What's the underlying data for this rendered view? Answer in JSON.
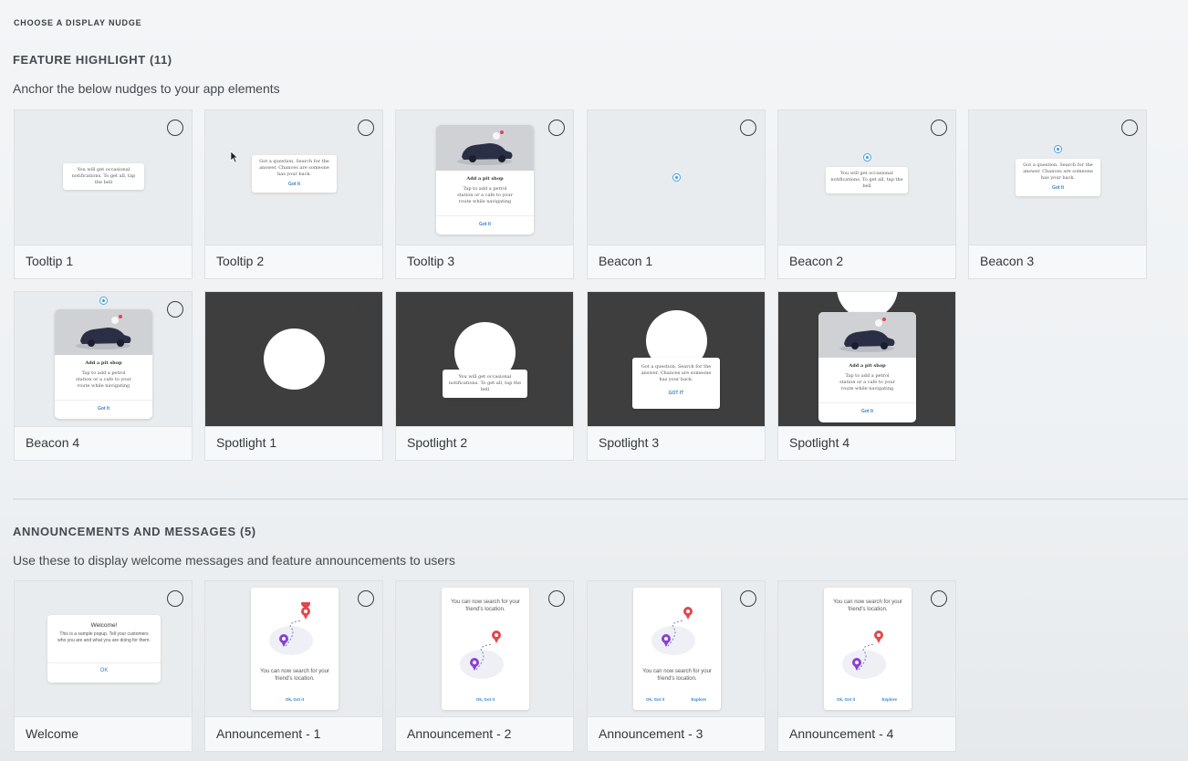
{
  "header": {
    "title": "CHOOSE A DISPLAY NUDGE"
  },
  "feature_highlight": {
    "title": "FEATURE HIGHLIGHT (11)",
    "description": "Anchor the below nudges to your app elements",
    "cards": [
      {
        "label": "Tooltip 1",
        "preview_text": "You will get occasional notifications. To get all, tap the bell"
      },
      {
        "label": "Tooltip 2",
        "preview_text": "Got a question. Search for the answer. Chances are someone has your back.",
        "preview_action": "Got It"
      },
      {
        "label": "Tooltip 3",
        "preview_title": "Add a pit shop",
        "preview_text": "Tap to add a petrol station or a cafe to your route while navigating",
        "preview_action": "Got It"
      },
      {
        "label": "Beacon 1"
      },
      {
        "label": "Beacon 2",
        "preview_text": "You will get occasional notifications. To get all, tap the bell"
      },
      {
        "label": "Beacon 3",
        "preview_text": "Got a question. Search for the answer. Chances are someone has your back.",
        "preview_action": "Got It"
      },
      {
        "label": "Beacon 4",
        "preview_title": "Add a pit shop",
        "preview_text": "Tap to add a petrol station or a cafe to your route while navigating",
        "preview_action": "Got It"
      },
      {
        "label": "Spotlight 1"
      },
      {
        "label": "Spotlight 2",
        "preview_text": "You will get occasional notifications. To get all, tap the bell"
      },
      {
        "label": "Spotlight 3",
        "preview_text": "Got a question. Search for the answer. Chances are someone has your back.",
        "preview_action": "GOT IT"
      },
      {
        "label": "Spotlight 4",
        "preview_title": "Add a pit shop",
        "preview_text": "Tap to add a petrol station or a cafe to your route while navigating",
        "preview_action": "Got It"
      }
    ]
  },
  "announcements": {
    "title": "ANNOUNCEMENTS AND MESSAGES (5)",
    "description": "Use these to display welcome messages and feature announcements to users",
    "cards": [
      {
        "label": "Welcome",
        "preview_title": "Welcome!",
        "preview_text": "This is a sample popup. Tell your customers who you are and what you are doing for them.",
        "preview_action": "OK"
      },
      {
        "label": "Announcement - 1",
        "preview_text": "You can now search for your friend's location.",
        "preview_action": "Ok, Got it"
      },
      {
        "label": "Announcement - 2",
        "preview_text": "You can now search for your friend's location.",
        "preview_action": "Ok, Got it"
      },
      {
        "label": "Announcement - 3",
        "preview_text": "You can now search for your friend's location.",
        "preview_action": "Ok, Got it",
        "preview_action2": "Explore"
      },
      {
        "label": "Announcement - 4",
        "preview_text": "You can now search for your friend's location.",
        "preview_action": "Ok, Got it",
        "preview_action2": "Explore"
      }
    ]
  },
  "colors": {
    "accent": "#3b82c4",
    "beacon": "#3a97db",
    "dark_preview": "#3e3e3e",
    "map_pin_red": "#e2474c",
    "map_pin_purple": "#8a3fd1"
  },
  "icons": {
    "radio": "radio-unchecked-icon",
    "beacon": "beacon-dot-icon",
    "car": "car-illustration-icon",
    "pin": "map-pin-icon"
  }
}
